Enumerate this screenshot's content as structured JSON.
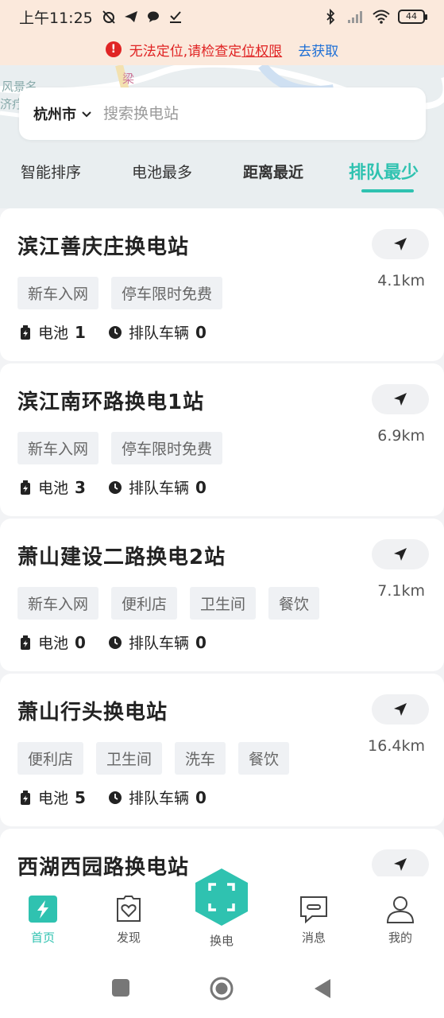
{
  "status_bar": {
    "time": "上午11:25",
    "battery": "44"
  },
  "warning": {
    "text_prefix": "无法定位,请检查定",
    "text_link": "位权限",
    "action": "去获取"
  },
  "map": {
    "label_1": "风景名",
    "label_2": "济疗",
    "label_3": "梁"
  },
  "search": {
    "city": "杭州市",
    "placeholder": "搜索换电站"
  },
  "sort_tabs": [
    {
      "label": "智能排序",
      "active": false
    },
    {
      "label": "电池最多",
      "active": false
    },
    {
      "label": "距离最近",
      "active": false
    },
    {
      "label": "排队最少",
      "active": true
    }
  ],
  "stations": [
    {
      "name": "滨江善庆庄换电站",
      "distance": "4.1km",
      "tags": [
        "新车入网",
        "停车限时免费"
      ],
      "battery_label": "电池",
      "battery": "1",
      "queue_label": "排队车辆",
      "queue": "0"
    },
    {
      "name": "滨江南环路换电1站",
      "distance": "6.9km",
      "tags": [
        "新车入网",
        "停车限时免费"
      ],
      "battery_label": "电池",
      "battery": "3",
      "queue_label": "排队车辆",
      "queue": "0"
    },
    {
      "name": "萧山建设二路换电2站",
      "distance": "7.1km",
      "tags": [
        "新车入网",
        "便利店",
        "卫生间",
        "餐饮"
      ],
      "battery_label": "电池",
      "battery": "0",
      "queue_label": "排队车辆",
      "queue": "0"
    },
    {
      "name": "萧山行头换电站",
      "distance": "16.4km",
      "tags": [
        "便利店",
        "卫生间",
        "洗车",
        "餐饮"
      ],
      "battery_label": "电池",
      "battery": "5",
      "queue_label": "排队车辆",
      "queue": "0"
    },
    {
      "name": "西湖西园路换电站"
    }
  ],
  "bottom_nav": [
    {
      "label": "首页",
      "icon": "home-bolt-icon",
      "active": true
    },
    {
      "label": "发现",
      "icon": "discover-heart-icon",
      "active": false
    },
    {
      "label": "换电",
      "icon": "scan-icon",
      "active": false
    },
    {
      "label": "消息",
      "icon": "message-icon",
      "active": false
    },
    {
      "label": "我的",
      "icon": "profile-icon",
      "active": false
    }
  ],
  "colors": {
    "accent": "#2fc2b0",
    "warning": "#e02424",
    "link": "#1d6fd6"
  }
}
